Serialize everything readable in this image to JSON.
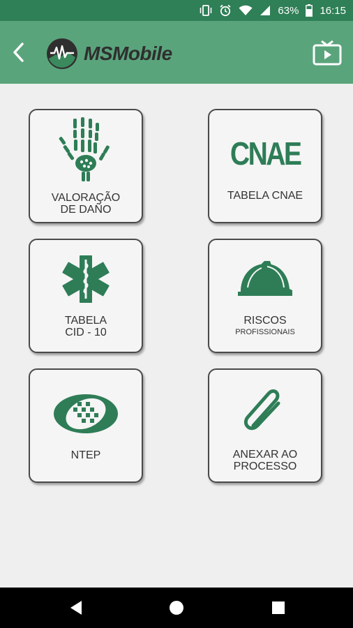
{
  "status_bar": {
    "battery": "63%",
    "time": "16:15",
    "icons": [
      "vibrate-icon",
      "alarm-icon",
      "wifi-icon",
      "signal-icon",
      "battery-icon"
    ]
  },
  "app_bar": {
    "title": "MSMobile",
    "back_icon": "back-arrow-icon",
    "action_icon": "tv-icon",
    "logo_mark_text": "MS"
  },
  "colors": {
    "status_bar": "#2f7f57",
    "app_bar": "#5aa47c",
    "icon_green": "#2e7d57",
    "background": "#efefef"
  },
  "tiles": [
    {
      "id": "valoracao",
      "line1": "VALORAÇÃO",
      "line2": "DE DAÑO",
      "small": "",
      "icon": "hand-bones-icon"
    },
    {
      "id": "cnae",
      "line1": "TABELA CNAE",
      "line2": "",
      "small": "",
      "icon": "cnae-logo-icon",
      "icon_text": "CNAE"
    },
    {
      "id": "cid",
      "line1": "TABELA",
      "line2": "CID - 10",
      "small": "",
      "icon": "star-of-life-icon"
    },
    {
      "id": "riscos",
      "line1": "RISCOS",
      "line2": "",
      "small": "PROFISSIONAIS",
      "icon": "hard-hat-icon"
    },
    {
      "id": "ntep",
      "line1": "NTEP",
      "line2": "",
      "small": "",
      "icon": "ntep-logo-icon"
    },
    {
      "id": "anexar",
      "line1": "ANEXAR AO",
      "line2": "PROCESSO",
      "small": "",
      "icon": "paperclip-icon"
    }
  ],
  "nav_bar": {
    "buttons": [
      "nav-back-icon",
      "nav-home-icon",
      "nav-recents-icon"
    ]
  }
}
